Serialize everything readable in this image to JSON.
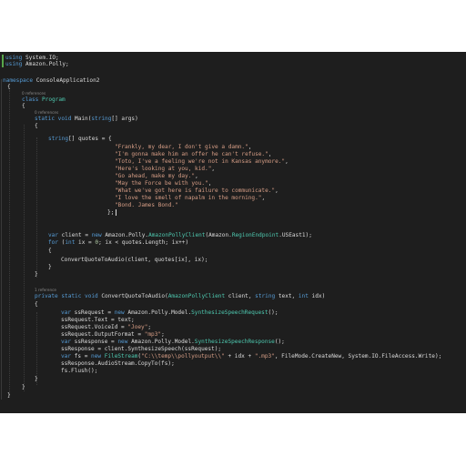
{
  "editor": {
    "using_lines": [
      {
        "kw": "using",
        "rest": " System.IO;"
      },
      {
        "kw": "using",
        "rest": " Amazon.Polly;"
      }
    ],
    "namespace_kw": "namespace",
    "namespace_name": " ConsoleApplication2",
    "class_ref": "0 references",
    "class_kw": "class",
    "class_name": " Program",
    "main_ref": "0 references",
    "main_sig": {
      "kw1": "static",
      "kw2": " void",
      "name": " Main(",
      "type": "string",
      "rest": "[] args)"
    },
    "quotes_decl": {
      "type": "string",
      "rest": "[] quotes = {"
    },
    "quotes": [
      "\"Frankly, my dear, I don't give a damn.\"",
      "\"I'm gonna make him an offer he can't refuse.\"",
      "\"Toto, I've a feeling we're not in Kansas anymore.\"",
      "\"Here's looking at you, kid.\"",
      "\"Go ahead, make my day.\"",
      "\"May the Force be with you.\"",
      "\"What we've got here is failure to communicate.\"",
      "\"I love the smell of napalm in the morning.\"",
      "\"Bond. James Bond.\""
    ],
    "quotes_close": "};",
    "client_line": {
      "kw": "var",
      "a": " client = ",
      "kw2": "new",
      "b": " Amazon.Polly.",
      "ty": "AmazonPollyClient",
      "c": "(Amazon.",
      "ty2": "RegionEndpoint",
      "d": ".USEast1);"
    },
    "for_line": {
      "kw": "for",
      "a": " (",
      "kw2": "int",
      "b": " ix = ",
      "n": "0",
      "c": "; ix < quotes.Length; ix++)"
    },
    "convert_call": "ConvertQuoteToAudio(client, quotes[ix], ix);",
    "method_ref": "1 reference",
    "method_sig": {
      "kw1": "private",
      "kw2": " static",
      "kw3": " void",
      "name": " ConvertQuoteToAudio(",
      "ty": "AmazonPollyClient",
      "a": " client, ",
      "kw4": "string",
      "b": " text, ",
      "kw5": "int",
      "c": " idx)"
    },
    "body": {
      "l1": {
        "kw": "var",
        "a": " ssRequest = ",
        "kw2": "new",
        "b": " Amazon.Polly.Model.",
        "ty": "SynthesizeSpeechRequest",
        "c": "();"
      },
      "l2": "ssRequest.Text = text;",
      "l3": {
        "a": "ssRequest.VoiceId = ",
        "s": "\"Joey\"",
        "b": ";"
      },
      "l4": {
        "a": "ssRequest.OutputFormat = ",
        "s": "\"mp3\"",
        "b": ";"
      },
      "l5": {
        "kw": "var",
        "a": " ssResponse = ",
        "kw2": "new",
        "b": " Amazon.Polly.Model.",
        "ty": "SynthesizeSpeechResponse",
        "c": "();"
      },
      "l6": "ssResponse = client.SynthesizeSpeech(ssRequest);",
      "l7": {
        "kw": "var",
        "a": " fs = ",
        "kw2": "new",
        "ty": " FileStream",
        "b": "(",
        "s1": "\"C:\\\\temp\\\\pollyoutput\\\\\"",
        "c": " + idx + ",
        "s2": "\".mp3\"",
        "d": ", FileMode.CreateNew, System.IO.FileAccess.Write);"
      },
      "l8": "ssResponse.AudioStream.CopyTo(fs);",
      "l9": "fs.Flush();"
    },
    "brace_open": "{",
    "brace_close": "}"
  }
}
